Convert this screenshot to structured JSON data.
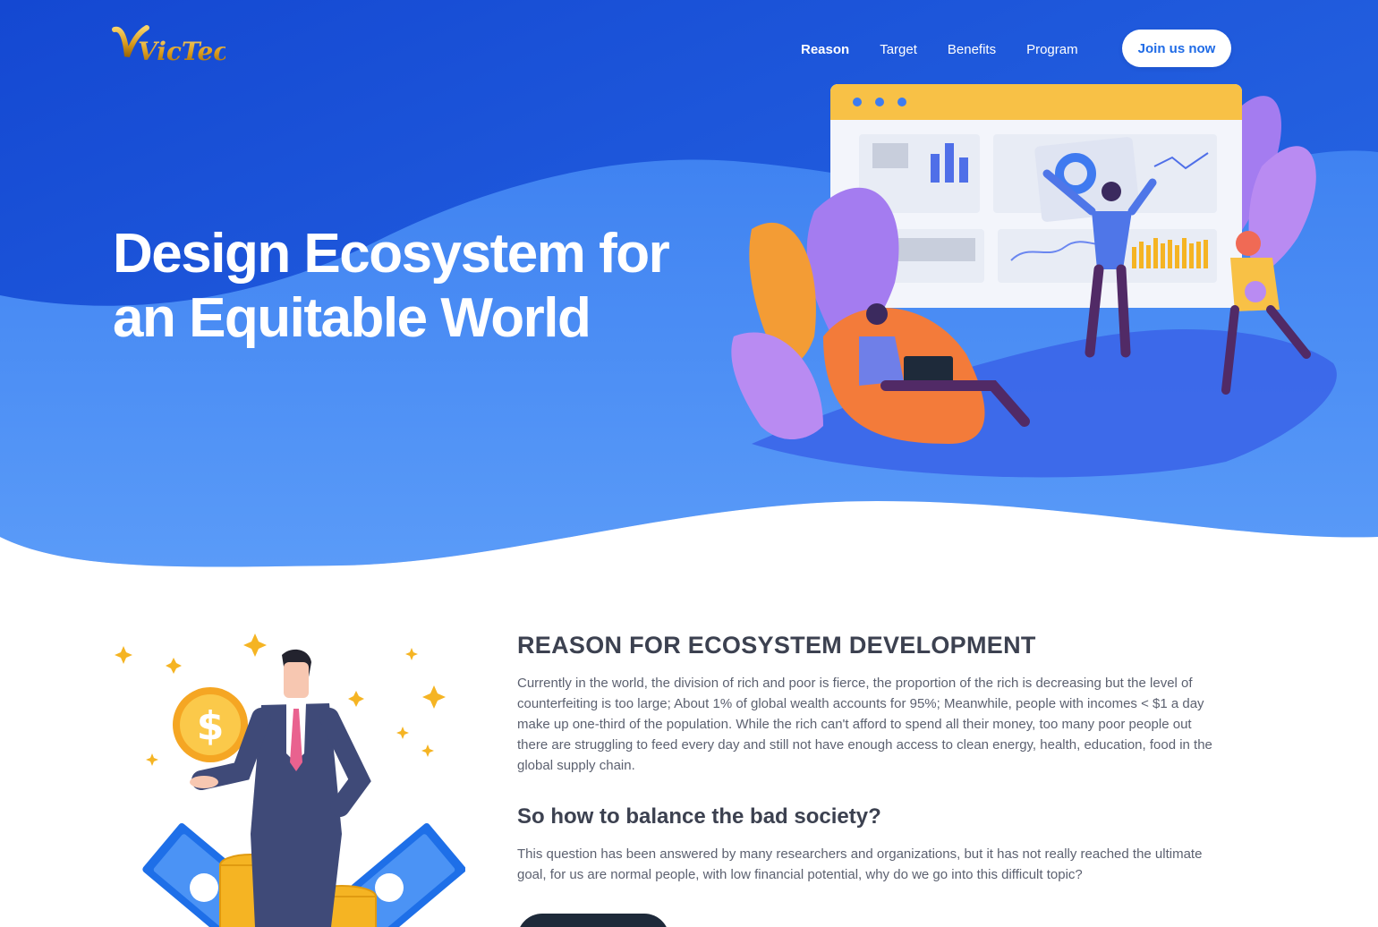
{
  "nav": {
    "logo_text": "VicTechco",
    "links": [
      {
        "label": "Reason",
        "active": true
      },
      {
        "label": "Target",
        "active": false
      },
      {
        "label": "Benefits",
        "active": false
      },
      {
        "label": "Program",
        "active": false
      }
    ],
    "cta_label": "Join us now"
  },
  "hero": {
    "title_line1": "Design Ecosystem for",
    "title_line2": "an Equitable World"
  },
  "reason": {
    "heading": "REASON FOR ECOSYSTEM DEVELOPMENT",
    "paragraph1": "Currently in the world, the division of rich and poor is fierce, the proportion of the rich is decreasing but the level of counterfeiting is too large; About 1% of global wealth accounts for 95%; Meanwhile, people with incomes < $1 a day make up one-third of the population. While the rich can't afford to spend all their money, too many poor people out there are struggling to feed every day and still not have enough access to clean energy, health, education, food in the global supply chain.",
    "subheading": "So how to balance the bad society?",
    "paragraph2": "This question has been answered by many researchers and organizations, but it has not really reached the ultimate goal, for us are normal people, with low financial potential, why do we go into this difficult topic?"
  },
  "colors": {
    "hero_dark": "#1552d8",
    "hero_light": "#4d8ff5",
    "accent": "#1f6be6",
    "heading": "#3c4150",
    "body_text": "#5c6170",
    "gold": "#f5b423"
  },
  "icons": [
    "dollar-coin-icon",
    "dollar-bill-icon",
    "sparkle-icon"
  ]
}
